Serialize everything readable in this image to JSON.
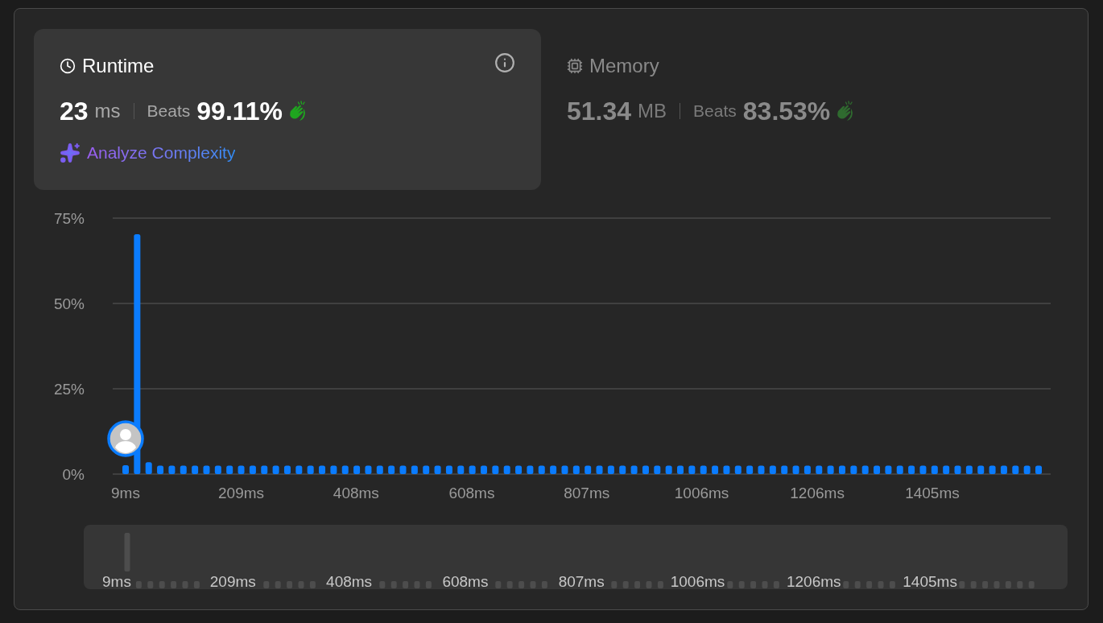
{
  "cards": [
    {
      "kind": "runtime",
      "title": "Runtime",
      "selected": true,
      "info_button": true,
      "value": "23",
      "unit": "ms",
      "beats_label": "Beats",
      "beats": "99.11%",
      "link": "Analyze Complexity"
    },
    {
      "kind": "memory",
      "title": "Memory",
      "selected": false,
      "info_button": false,
      "value": "51.34",
      "unit": "MB",
      "beats_label": "Beats",
      "beats": "83.53%"
    }
  ],
  "chart": {
    "chart_data": {
      "type": "bar",
      "ylim": [
        0,
        75
      ],
      "xlim": [
        9,
        1589
      ],
      "yticks": [
        {
          "value": 0,
          "label": "0%"
        },
        {
          "value": 25,
          "label": "25%"
        },
        {
          "value": 50,
          "label": "50%"
        },
        {
          "value": 75,
          "label": "75%"
        }
      ],
      "xticks": [
        {
          "value": 9,
          "label": "9ms"
        },
        {
          "value": 209,
          "label": "209ms"
        },
        {
          "value": 408,
          "label": "408ms"
        },
        {
          "value": 608,
          "label": "608ms"
        },
        {
          "value": 807,
          "label": "807ms"
        },
        {
          "value": 1006,
          "label": "1006ms"
        },
        {
          "value": 1206,
          "label": "1206ms"
        },
        {
          "value": 1405,
          "label": "1405ms"
        }
      ],
      "x": [
        9,
        29,
        49,
        69,
        89,
        109,
        129,
        149,
        169,
        189,
        209,
        229,
        249,
        269,
        289,
        309,
        329,
        349,
        369,
        389,
        409,
        429,
        449,
        469,
        489,
        509,
        529,
        549,
        569,
        589,
        609,
        629,
        649,
        669,
        689,
        709,
        729,
        749,
        769,
        789,
        809,
        829,
        849,
        869,
        889,
        909,
        929,
        949,
        969,
        989,
        1009,
        1029,
        1049,
        1069,
        1089,
        1109,
        1129,
        1149,
        1169,
        1189,
        1209,
        1229,
        1249,
        1269,
        1289,
        1309,
        1329,
        1349,
        1369,
        1389,
        1409,
        1429,
        1449,
        1469,
        1489,
        1509,
        1529,
        1549,
        1569,
        1589
      ],
      "values": [
        2.6,
        70.3,
        3.5,
        2.5,
        2.5,
        2.5,
        2.5,
        2.5,
        2.5,
        2.5,
        2.5,
        2.5,
        2.5,
        2.5,
        2.5,
        2.5,
        2.5,
        2.5,
        2.5,
        2.5,
        2.5,
        2.5,
        2.5,
        2.5,
        2.5,
        2.5,
        2.5,
        2.5,
        2.5,
        2.5,
        2.5,
        2.5,
        2.5,
        2.5,
        2.5,
        2.5,
        2.5,
        2.5,
        2.5,
        2.5,
        2.5,
        2.5,
        2.5,
        2.5,
        2.5,
        2.5,
        2.5,
        2.5,
        2.5,
        2.5,
        2.5,
        2.5,
        2.5,
        2.5,
        2.5,
        2.5,
        2.5,
        2.5,
        2.5,
        2.5,
        2.5,
        2.5,
        2.5,
        2.5,
        2.5,
        2.5,
        2.5,
        2.5,
        2.5,
        2.5,
        2.5,
        2.5,
        2.5,
        2.5,
        2.5,
        2.5,
        2.5,
        2.5,
        2.5,
        2.5
      ]
    }
  },
  "navigator": {
    "labels": [
      "9ms",
      "209ms",
      "408ms",
      "608ms",
      "807ms",
      "1006ms",
      "1206ms",
      "1405ms"
    ]
  }
}
